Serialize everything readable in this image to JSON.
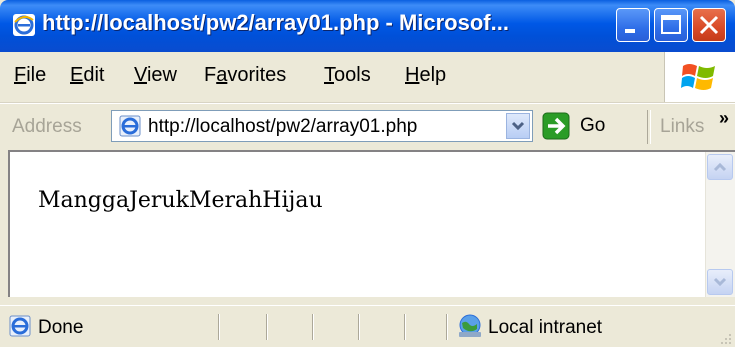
{
  "window": {
    "title": "http://localhost/pw2/array01.php - Microsof..."
  },
  "menu": [
    "File",
    "Edit",
    "View",
    "Favorites",
    "Tools",
    "Help"
  ],
  "menu_mnemonics": [
    "F",
    "E",
    "V",
    "a",
    "T",
    "H"
  ],
  "address": {
    "label": "Address",
    "url": "http://localhost/pw2/array01.php"
  },
  "go": {
    "label": "Go"
  },
  "links": {
    "label": "Links",
    "more": "»"
  },
  "page": {
    "content": "ManggaJerukMerahHijau"
  },
  "status": {
    "text": "Done",
    "zone": "Local intranet"
  },
  "colors": {
    "titlebar": "#0058e6",
    "go_green": "#2b9c27",
    "close_red": "#d94a27"
  },
  "icons": {
    "title": "ie-icon",
    "brand": "windows-flag-icon",
    "address": "ie-page-icon",
    "go": "go-arrow-icon",
    "status": "ie-page-icon",
    "zone": "local-intranet-icon"
  }
}
